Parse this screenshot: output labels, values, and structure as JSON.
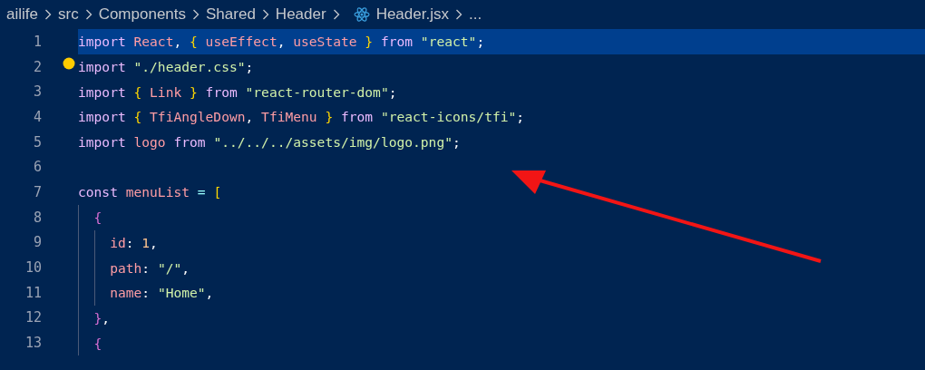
{
  "breadcrumb": [
    {
      "label": "ailife",
      "kind": "folder"
    },
    {
      "label": "src",
      "kind": "folder"
    },
    {
      "label": "Components",
      "kind": "folder"
    },
    {
      "label": "Shared",
      "kind": "folder"
    },
    {
      "label": "Header",
      "kind": "folder"
    },
    {
      "label": "Header.jsx",
      "kind": "file"
    },
    {
      "label": "...",
      "kind": "more"
    }
  ],
  "editor": {
    "lines": [
      {
        "number": "1",
        "selected": true,
        "lightbulb": false,
        "tokens": [
          {
            "text": "import",
            "kind": "keyword"
          },
          {
            "text": " React",
            "kind": "ident"
          },
          {
            "text": ", ",
            "kind": "punct"
          },
          {
            "text": "{",
            "kind": "brace1"
          },
          {
            "text": " useEffect",
            "kind": "ident"
          },
          {
            "text": ", ",
            "kind": "punct"
          },
          {
            "text": "useState",
            "kind": "ident"
          },
          {
            "text": " }",
            "kind": "brace1"
          },
          {
            "text": " from ",
            "kind": "keyword"
          },
          {
            "text": "\"react\"",
            "kind": "string"
          },
          {
            "text": ";",
            "kind": "punct"
          }
        ]
      },
      {
        "number": "2",
        "selected": false,
        "lightbulb": true,
        "tokens": [
          {
            "text": "import",
            "kind": "keyword"
          },
          {
            "text": " \"./header.css\"",
            "kind": "string"
          },
          {
            "text": ";",
            "kind": "punct"
          }
        ]
      },
      {
        "number": "3",
        "selected": false,
        "lightbulb": false,
        "tokens": [
          {
            "text": "import",
            "kind": "keyword"
          },
          {
            "text": " {",
            "kind": "brace1"
          },
          {
            "text": " Link",
            "kind": "ident"
          },
          {
            "text": " }",
            "kind": "brace1"
          },
          {
            "text": " from ",
            "kind": "keyword"
          },
          {
            "text": "\"react-router-dom\"",
            "kind": "string"
          },
          {
            "text": ";",
            "kind": "punct"
          }
        ]
      },
      {
        "number": "4",
        "selected": false,
        "lightbulb": false,
        "tokens": [
          {
            "text": "import",
            "kind": "keyword"
          },
          {
            "text": " {",
            "kind": "brace1"
          },
          {
            "text": " TfiAngleDown",
            "kind": "ident"
          },
          {
            "text": ", ",
            "kind": "punct"
          },
          {
            "text": "TfiMenu",
            "kind": "ident"
          },
          {
            "text": " }",
            "kind": "brace1"
          },
          {
            "text": " from ",
            "kind": "keyword"
          },
          {
            "text": "\"react-icons/tfi\"",
            "kind": "string"
          },
          {
            "text": ";",
            "kind": "punct"
          }
        ]
      },
      {
        "number": "5",
        "selected": false,
        "lightbulb": false,
        "tokens": [
          {
            "text": "import",
            "kind": "keyword"
          },
          {
            "text": " logo",
            "kind": "ident"
          },
          {
            "text": " from ",
            "kind": "keyword"
          },
          {
            "text": "\"../../../assets/img/logo.png\"",
            "kind": "string"
          },
          {
            "text": ";",
            "kind": "punct"
          }
        ]
      },
      {
        "number": "6",
        "selected": false,
        "lightbulb": false
      },
      {
        "number": "7",
        "selected": false,
        "lightbulb": false,
        "tokens": [
          {
            "text": "const",
            "kind": "keyword"
          },
          {
            "text": " menuList",
            "kind": "ident"
          },
          {
            "text": " = ",
            "kind": "operator"
          },
          {
            "text": "[",
            "kind": "brace1"
          }
        ]
      },
      {
        "number": "8",
        "selected": false,
        "lightbulb": false,
        "tokens": [
          {
            "text": "  {",
            "kind": "brace2"
          }
        ]
      },
      {
        "number": "9",
        "selected": false,
        "lightbulb": false,
        "tokens": [
          {
            "text": "    id",
            "kind": "ident"
          },
          {
            "text": ": ",
            "kind": "punct"
          },
          {
            "text": "1",
            "kind": "number"
          },
          {
            "text": ",",
            "kind": "punct"
          }
        ]
      },
      {
        "number": "10",
        "selected": false,
        "lightbulb": false,
        "tokens": [
          {
            "text": "    path",
            "kind": "ident"
          },
          {
            "text": ": ",
            "kind": "punct"
          },
          {
            "text": "\"/\"",
            "kind": "string"
          },
          {
            "text": ",",
            "kind": "punct"
          }
        ]
      },
      {
        "number": "11",
        "selected": false,
        "lightbulb": false,
        "tokens": [
          {
            "text": "    name",
            "kind": "ident"
          },
          {
            "text": ": ",
            "kind": "punct"
          },
          {
            "text": "\"Home\"",
            "kind": "string"
          },
          {
            "text": ",",
            "kind": "punct"
          }
        ]
      },
      {
        "number": "12",
        "selected": false,
        "lightbulb": false,
        "tokens": [
          {
            "text": "  }",
            "kind": "brace2"
          },
          {
            "text": ",",
            "kind": "punct"
          }
        ]
      },
      {
        "number": "13",
        "selected": false,
        "lightbulb": false,
        "tokens": [
          {
            "text": "  {",
            "kind": "brace2"
          }
        ]
      }
    ]
  }
}
